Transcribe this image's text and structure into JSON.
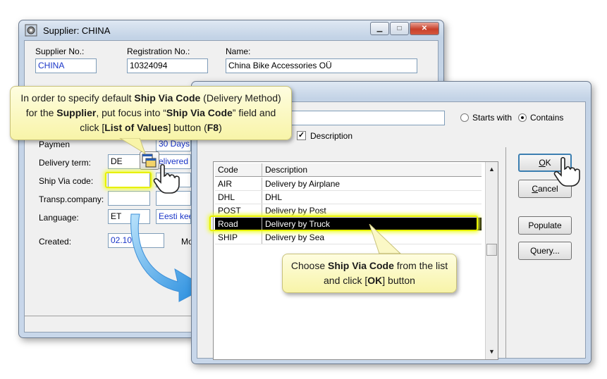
{
  "supplier_window": {
    "title": "Supplier: CHINA",
    "fields": {
      "supplier_no": {
        "label": "Supplier No.:",
        "value": "CHINA"
      },
      "registration_no": {
        "label": "Registration No.:",
        "value": "10324094"
      },
      "name": {
        "label": "Name:",
        "value": "China Bike Accessories OÜ"
      },
      "payment": {
        "label": "Paymen",
        "value": "30 Days"
      },
      "delivery_term": {
        "label": "Delivery term:",
        "code": "DE",
        "value": "elivered"
      },
      "ship_via": {
        "label": "Ship Via code:",
        "value": ""
      },
      "transp_company": {
        "label": "Transp.company:",
        "value": ""
      },
      "language": {
        "label": "Language:",
        "code": "ET",
        "value": "Eesti kee"
      },
      "created": {
        "label": "Created:",
        "value": "02.10.",
        "extra_label": "Mo"
      }
    }
  },
  "lov_window": {
    "search_value": "",
    "options": {
      "starts_with": "Starts with",
      "contains": "Contains",
      "description": "Description"
    },
    "columns": {
      "code": "Code",
      "description": "Description"
    },
    "rows": [
      {
        "code": "AIR",
        "description": "Delivery by Airplane"
      },
      {
        "code": "DHL",
        "description": "DHL"
      },
      {
        "code": "POST",
        "description": "Delivery by Post"
      },
      {
        "code": "Road",
        "description": "Delivery by Truck"
      },
      {
        "code": "SHIP",
        "description": "Delivery by Sea"
      }
    ],
    "buttons": {
      "ok": {
        "mnemonic": "O",
        "rest": "K"
      },
      "cancel": {
        "mnemonic": "C",
        "rest": "ancel"
      },
      "populate": "Populate",
      "query": "Query..."
    }
  },
  "callouts": {
    "top": {
      "p1": "In order to specify default ",
      "b1": "Ship Via Code",
      "p2": " (Delivery Method) for the ",
      "b2": "Supplier",
      "p3": ", put focus into “",
      "b3": "Ship Via Code",
      "p4": "” field and click [",
      "b4": "List of Values",
      "p5": "] button (",
      "b5": "F8",
      "p6": ")"
    },
    "bottom": {
      "p1": "Choose ",
      "b1": "Ship Via Code",
      "p2": " from the list and click [",
      "b2": "OK",
      "p3": "] button"
    }
  },
  "colors": {
    "highlight": "#e7f000",
    "arrow": "#3aa0e8",
    "callout_bg": "#f8f4a8",
    "link_text": "#1a35c8"
  }
}
